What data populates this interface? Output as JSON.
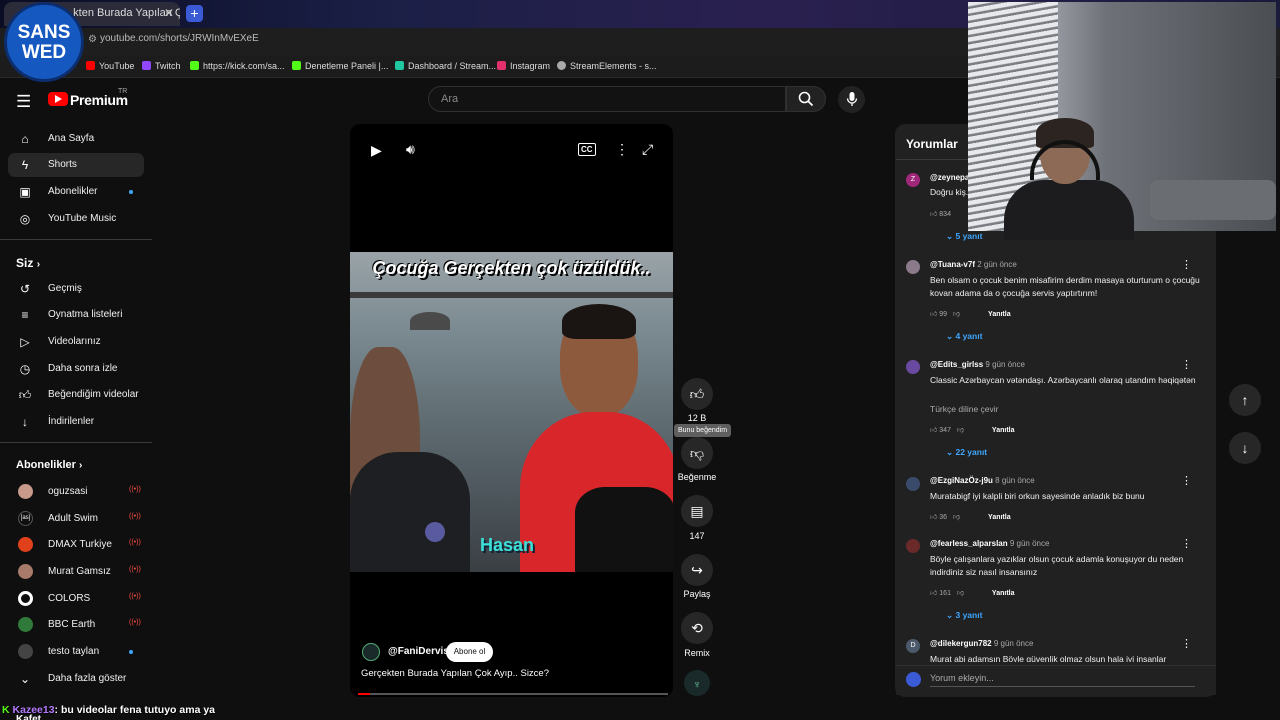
{
  "browser": {
    "tab_title": "...kten Burada Yapılan Çok",
    "url": "youtube.com/shorts/JRWInMvEXeE",
    "bookmarks": [
      {
        "label": "YouTube",
        "color": "#ff0000"
      },
      {
        "label": "Twitch",
        "color": "#9146ff"
      },
      {
        "label": "https://kick.com/sa...",
        "color": "#53fc18"
      },
      {
        "label": "Denetleme Paneli |...",
        "color": "#53fc18"
      },
      {
        "label": "Dashboard / Stream...",
        "color": "#1fc8a0"
      },
      {
        "label": "Instagram",
        "color": "#e1306c"
      },
      {
        "label": "StreamElements - s...",
        "color": "#aaaaaa"
      }
    ]
  },
  "overlay_logo": {
    "line1": "SANS",
    "line2": "WED"
  },
  "masthead": {
    "brand": "Premium",
    "country": "TR",
    "search_placeholder": "Ara"
  },
  "sidebar": {
    "main": [
      {
        "label": "Ana Sayfa",
        "icon": "home-icon"
      },
      {
        "label": "Shorts",
        "icon": "shorts-icon"
      },
      {
        "label": "Abonelikler",
        "icon": "subscriptions-icon"
      },
      {
        "label": "YouTube Music",
        "icon": "music-icon"
      }
    ],
    "you_title": "Siz",
    "you": [
      {
        "label": "Geçmiş",
        "icon": "history-icon"
      },
      {
        "label": "Oynatma listeleri",
        "icon": "playlist-icon"
      },
      {
        "label": "Videolarınız",
        "icon": "your-videos-icon"
      },
      {
        "label": "Daha sonra izle",
        "icon": "watch-later-icon"
      },
      {
        "label": "Beğendiğim videolar",
        "icon": "liked-icon"
      },
      {
        "label": "İndirilenler",
        "icon": "download-icon"
      }
    ],
    "subs_title": "Abonelikler",
    "subs": [
      {
        "label": "oguzsasi",
        "status": "live",
        "avatar": "#c79a8a"
      },
      {
        "label": "Adult Swim",
        "status": "live",
        "avatar": "#0f0f0f"
      },
      {
        "label": "DMAX Turkiye",
        "status": "live",
        "avatar": "#e0401a"
      },
      {
        "label": "Murat Gamsız",
        "status": "live",
        "avatar": "#a87a6a"
      },
      {
        "label": "COLORS",
        "status": "live",
        "avatar": "#ffffff"
      },
      {
        "label": "BBC Earth",
        "status": "live",
        "avatar": "#2f7a3a"
      },
      {
        "label": "testo taylan",
        "status": "new",
        "avatar": "#444444"
      }
    ],
    "show_more": "Daha fazla göster"
  },
  "short": {
    "title_overlay": "Çocuğa Gerçekten çok üzüldük..",
    "name_overlay": "Hasan",
    "channel": "@FaniDervis",
    "subscribe": "Abone ol",
    "caption": "Gerçekten Burada Yapılan Çok Ayıp.. Sizce?",
    "progress": 0.04
  },
  "actions": {
    "likes": "12 B",
    "tooltip": "Bunu beğendim",
    "dislike": "Beğenme",
    "comments": "147",
    "share": "Paylaş",
    "remix": "Remix"
  },
  "comments": {
    "title": "Yorumlar",
    "input_placeholder": "Yorum ekleyin...",
    "items": [
      {
        "user": "@zeynepa...",
        "time": "",
        "text": "Doğru kiş...",
        "likes": "834",
        "reply": "",
        "replies": "5 yanıt",
        "initial": "Z",
        "color": "#a0287a"
      },
      {
        "user": "@Tuana-v7f",
        "time": "2 gün önce",
        "text": "Ben olsam o çocuk benim misafirim derdim masaya oturturum o çocuğu kovan adama da o çocuğa servis yaptırtırım!",
        "likes": "99",
        "reply": "Yanıtla",
        "replies": "4 yanıt",
        "initial": "",
        "color": "#8a7a8a"
      },
      {
        "user": "@Edits_girlss",
        "time": "9 gün önce",
        "text": "Classic Azərbaycan vətəndaşı. Azərbaycanlı olaraq utandım həqiqətən",
        "translate": "Türkçe diline çevir",
        "likes": "347",
        "reply": "Yanıtla",
        "replies": "22 yanıt",
        "initial": "",
        "color": "#6a4aa0"
      },
      {
        "user": "@EzgiNazÖz-j9u",
        "time": "8 gün önce",
        "text": "Muratabigf iyi kalpli biri orkun sayesinde anladık biz bunu",
        "likes": "36",
        "reply": "Yanıtla",
        "replies": "",
        "initial": "",
        "color": "#3a4a6a"
      },
      {
        "user": "@fearless_alparslan",
        "time": "9 gün önce",
        "text": "Böyle çalışanlara yazıklar olsun  çocuk adamla konuşuyor du neden indirdiniz siz nasıl insansınız",
        "likes": "161",
        "reply": "Yanıtla",
        "replies": "3 yanıt",
        "initial": "",
        "color": "#6a2a2a"
      },
      {
        "user": "@dilekergun782",
        "time": "9 gün önce",
        "text": "Murat abi adamsın Böyle güvenlik olmaz olsun hala iyi insanlar",
        "likes": "",
        "reply": "",
        "replies": "",
        "initial": "D",
        "color": "#4a5a6a"
      }
    ]
  },
  "chat": {
    "user": "Kazee13",
    "message": ": bu videolar fena tutuyo ama ya",
    "line2": "Kafet..."
  }
}
